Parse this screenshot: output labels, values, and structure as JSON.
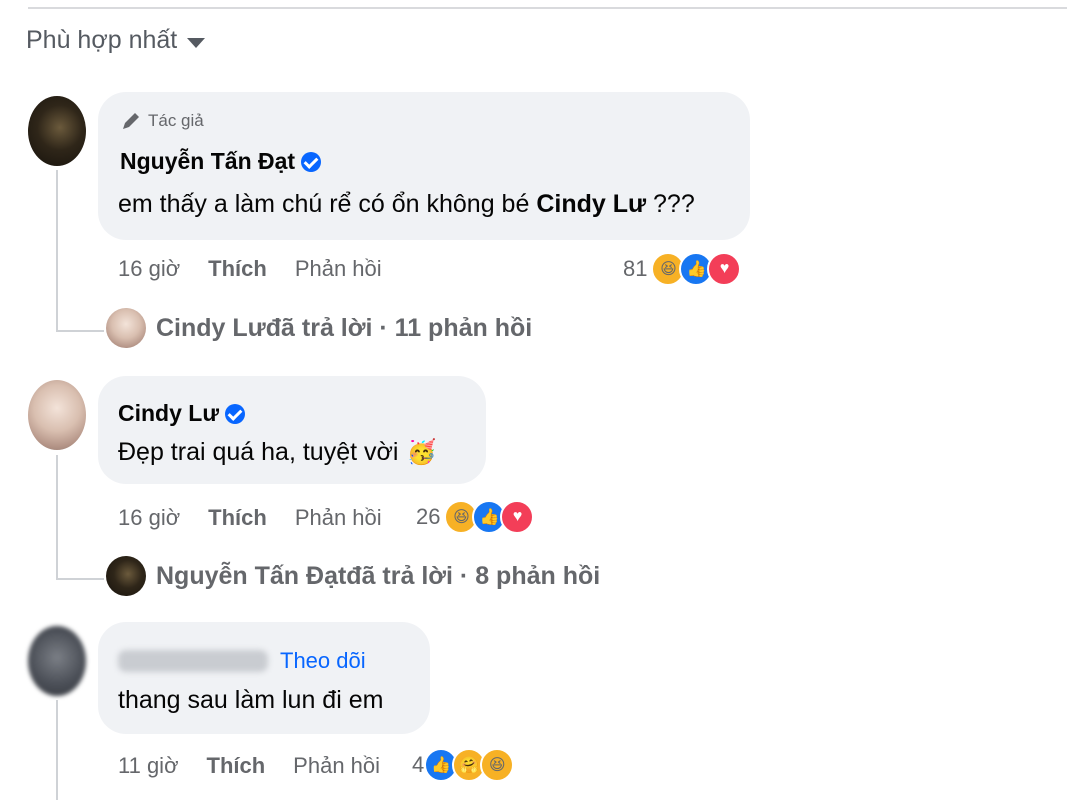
{
  "sort": {
    "label": "Phù hợp nhất"
  },
  "comments": [
    {
      "author_tag": "Tác giả",
      "name": "Nguyễn Tấn Đạt",
      "text_before": "em thấy a làm chú rể có ổn không bé ",
      "mention": "Cindy Lư",
      "text_after": " ???",
      "time": "16 giờ",
      "like_label": "Thích",
      "reply_label": "Phản hồi",
      "reaction_count": "81",
      "replies": {
        "name": "Cindy Lư",
        "summary": " đã trả lời · 11 phản hồi"
      }
    },
    {
      "name": "Cindy Lư",
      "text": "Đẹp trai quá ha, tuyệt vời",
      "time": "16 giờ",
      "like_label": "Thích",
      "reply_label": "Phản hồi",
      "reaction_count": "26",
      "replies": {
        "name": "Nguyễn Tấn Đạt",
        "summary": " đã trả lời · 8 phản hồi"
      }
    },
    {
      "follow_label": "Theo dõi",
      "text": "thang sau làm lun đi em",
      "time": "11 giờ",
      "like_label": "Thích",
      "reply_label": "Phản hồi",
      "reaction_count": "4"
    }
  ],
  "icons": {
    "sort": "caret-down-icon",
    "author": "pencil-icon",
    "verified": "verified-badge-icon",
    "reactions": [
      "haha-icon",
      "like-icon",
      "love-icon",
      "care-icon"
    ]
  },
  "colors": {
    "link": "#0866ff",
    "bubble": "#f0f2f5",
    "meta": "#65676b",
    "like": "#1877f2",
    "love": "#f33e58",
    "haha": "#f7b125"
  }
}
